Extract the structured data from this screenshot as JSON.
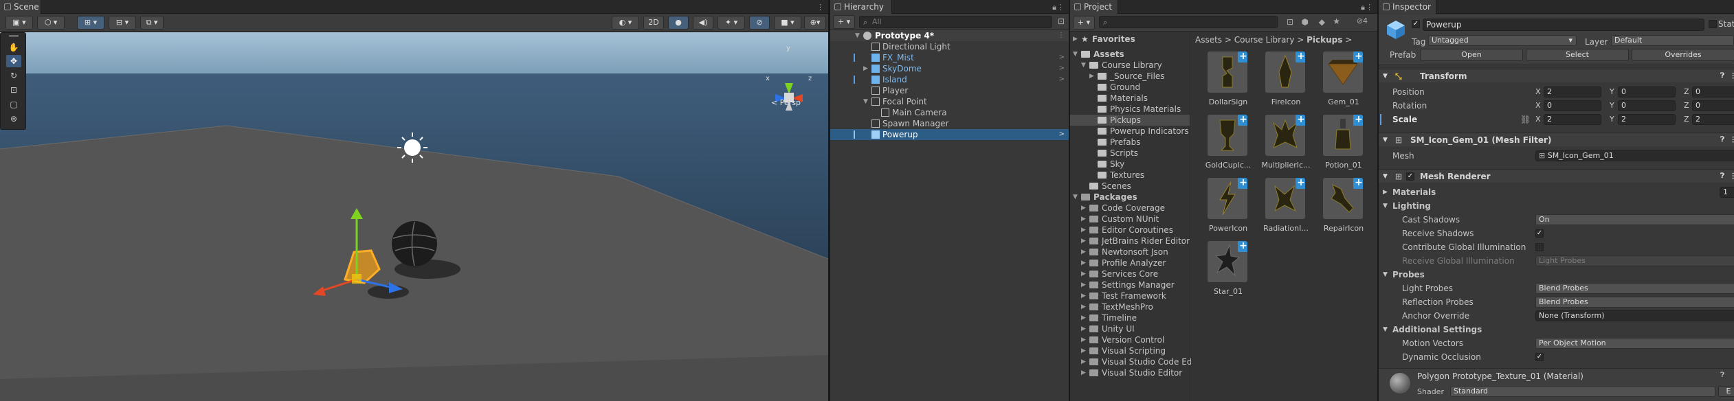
{
  "scene": {
    "tab": "Scene",
    "toolbar": {
      "btn_2d": "2D"
    },
    "persp_label": "< Persp",
    "gizmo_axes": [
      "y",
      "x",
      "z"
    ]
  },
  "hierarchy": {
    "tab": "Hierarchy",
    "add_label": "+",
    "search_placeholder": "All",
    "items": [
      {
        "label": "Prototype 4*",
        "kind": "scene"
      },
      {
        "label": "Directional Light"
      },
      {
        "label": "FX_Mist"
      },
      {
        "label": "SkyDome"
      },
      {
        "label": "Island"
      },
      {
        "label": "Player"
      },
      {
        "label": "Focal Point"
      },
      {
        "label": "Main Camera"
      },
      {
        "label": "Spawn Manager"
      },
      {
        "label": "Powerup"
      }
    ]
  },
  "project": {
    "tab": "Project",
    "add_label": "+",
    "hidden_count": "4",
    "breadcrumb": [
      "Assets",
      "Course Library",
      "Pickups"
    ],
    "tree": [
      "Favorites",
      "Assets",
      "Course Library",
      "_Source_Files",
      "Ground",
      "Materials",
      "Physics Materials",
      "Pickups",
      "Powerup Indicators",
      "Prefabs",
      "Scripts",
      "Sky",
      "Textures",
      "Scenes",
      "Packages",
      "Code Coverage",
      "Custom NUnit",
      "Editor Coroutines",
      "JetBrains Rider Editor",
      "Newtonsoft Json",
      "Profile Analyzer",
      "Services Core",
      "Settings Manager",
      "Test Framework",
      "TextMeshPro",
      "Timeline",
      "Unity UI",
      "Version Control",
      "Visual Scripting",
      "Visual Studio Code Ed",
      "Visual Studio Editor"
    ],
    "assets": [
      "DollarSign",
      "FireIcon",
      "Gem_01",
      "GoldCuplc...",
      "MultiplierIc...",
      "Potion_01",
      "PowerIcon",
      "RadiationI...",
      "RepairIcon",
      "Star_01"
    ]
  },
  "inspector": {
    "tab": "Inspector",
    "name": "Powerup",
    "static_label": "Stati",
    "tag_label": "Tag",
    "tag_value": "Untagged",
    "layer_label": "Layer",
    "layer_value": "Default",
    "prefab_label": "Prefab",
    "prefab_open": "Open",
    "prefab_select": "Select",
    "prefab_overrides": "Overrides",
    "transform": {
      "title": "Transform",
      "position_label": "Position",
      "rotation_label": "Rotation",
      "scale_label": "Scale",
      "position": [
        "2",
        "0",
        "0"
      ],
      "rotation": [
        "0",
        "0",
        "0"
      ],
      "scale": [
        "2",
        "2",
        "2"
      ]
    },
    "mesh_filter": {
      "title": "SM_Icon_Gem_01 (Mesh Filter)",
      "mesh_label": "Mesh",
      "mesh_value": "SM_Icon_Gem_01"
    },
    "mesh_renderer": {
      "title": "Mesh Renderer",
      "materials_label": "Materials",
      "materials_count": "1",
      "lighting_label": "Lighting",
      "cast_shadows_label": "Cast Shadows",
      "cast_shadows_value": "On",
      "receive_shadows_label": "Receive Shadows",
      "contribute_gi_label": "Contribute Global Illumination",
      "receive_gi_label": "Receive Global Illumination",
      "receive_gi_value": "Light Probes",
      "probes_label": "Probes",
      "light_probes_label": "Light Probes",
      "light_probes_value": "Blend Probes",
      "reflection_probes_label": "Reflection Probes",
      "reflection_probes_value": "Blend Probes",
      "anchor_override_label": "Anchor Override",
      "anchor_override_value": "None (Transform)",
      "additional_label": "Additional Settings",
      "motion_vectors_label": "Motion Vectors",
      "motion_vectors_value": "Per Object Motion",
      "dynamic_occlusion_label": "Dynamic Occlusion"
    },
    "material": {
      "title": "Polygon Prototype_Texture_01 (Material)",
      "shader_label": "Shader",
      "shader_value": "Standard"
    }
  },
  "colors": {
    "selection": "#2c5d87",
    "prefab_blue": "#7cbaf0",
    "accent": "#2f8fd2"
  }
}
